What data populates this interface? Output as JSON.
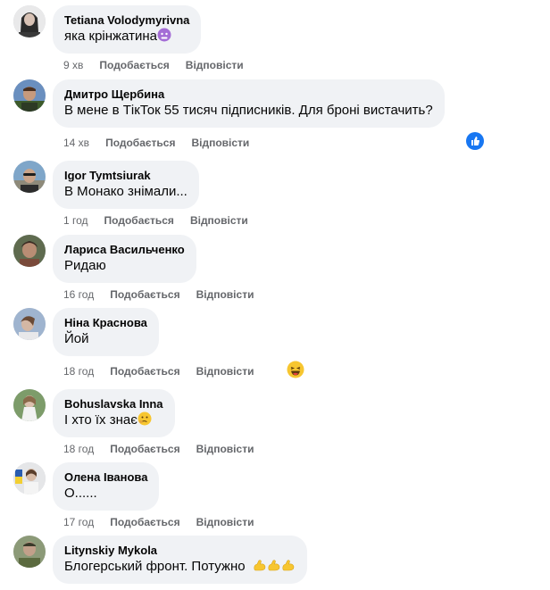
{
  "comments": [
    {
      "author": "Tetiana Volodymyrivna",
      "text": "яка крінжатина",
      "time": "9 хв",
      "like": "Подобається",
      "reply": "Відповісти"
    },
    {
      "author": "Дмитро Щербина",
      "text": "В мене в ТікТок 55 тисяч підписників. Для броні вистачить?",
      "time": "14 хв",
      "like": "Подобається",
      "reply": "Відповісти"
    },
    {
      "author": "Igor Tymtsiurak",
      "text": "В Монако знімали...",
      "time": "1 год",
      "like": "Подобається",
      "reply": "Відповісти"
    },
    {
      "author": "Лариса Васильченко",
      "text": "Ридаю",
      "time": "16 год",
      "like": "Подобається",
      "reply": "Відповісти"
    },
    {
      "author": "Ніна Краснова",
      "text": "Йой",
      "time": "18 год",
      "like": "Подобається",
      "reply": "Відповісти"
    },
    {
      "author": "Bohuslavska Inna",
      "text": "І хто їх знає",
      "time": "18 год",
      "like": "Подобається",
      "reply": "Відповісти"
    },
    {
      "author": "Олена Іванова",
      "text": "О......",
      "time": "17 год",
      "like": "Подобається",
      "reply": "Відповісти"
    },
    {
      "author": "Litynskiy Mykola",
      "text": "Блогерський фронт. Потужно",
      "time": "",
      "like": "",
      "reply": ""
    }
  ],
  "colors": {
    "bubble": "#f0f2f5",
    "meta_text": "#65676b",
    "like_blue": "#1877f2"
  }
}
